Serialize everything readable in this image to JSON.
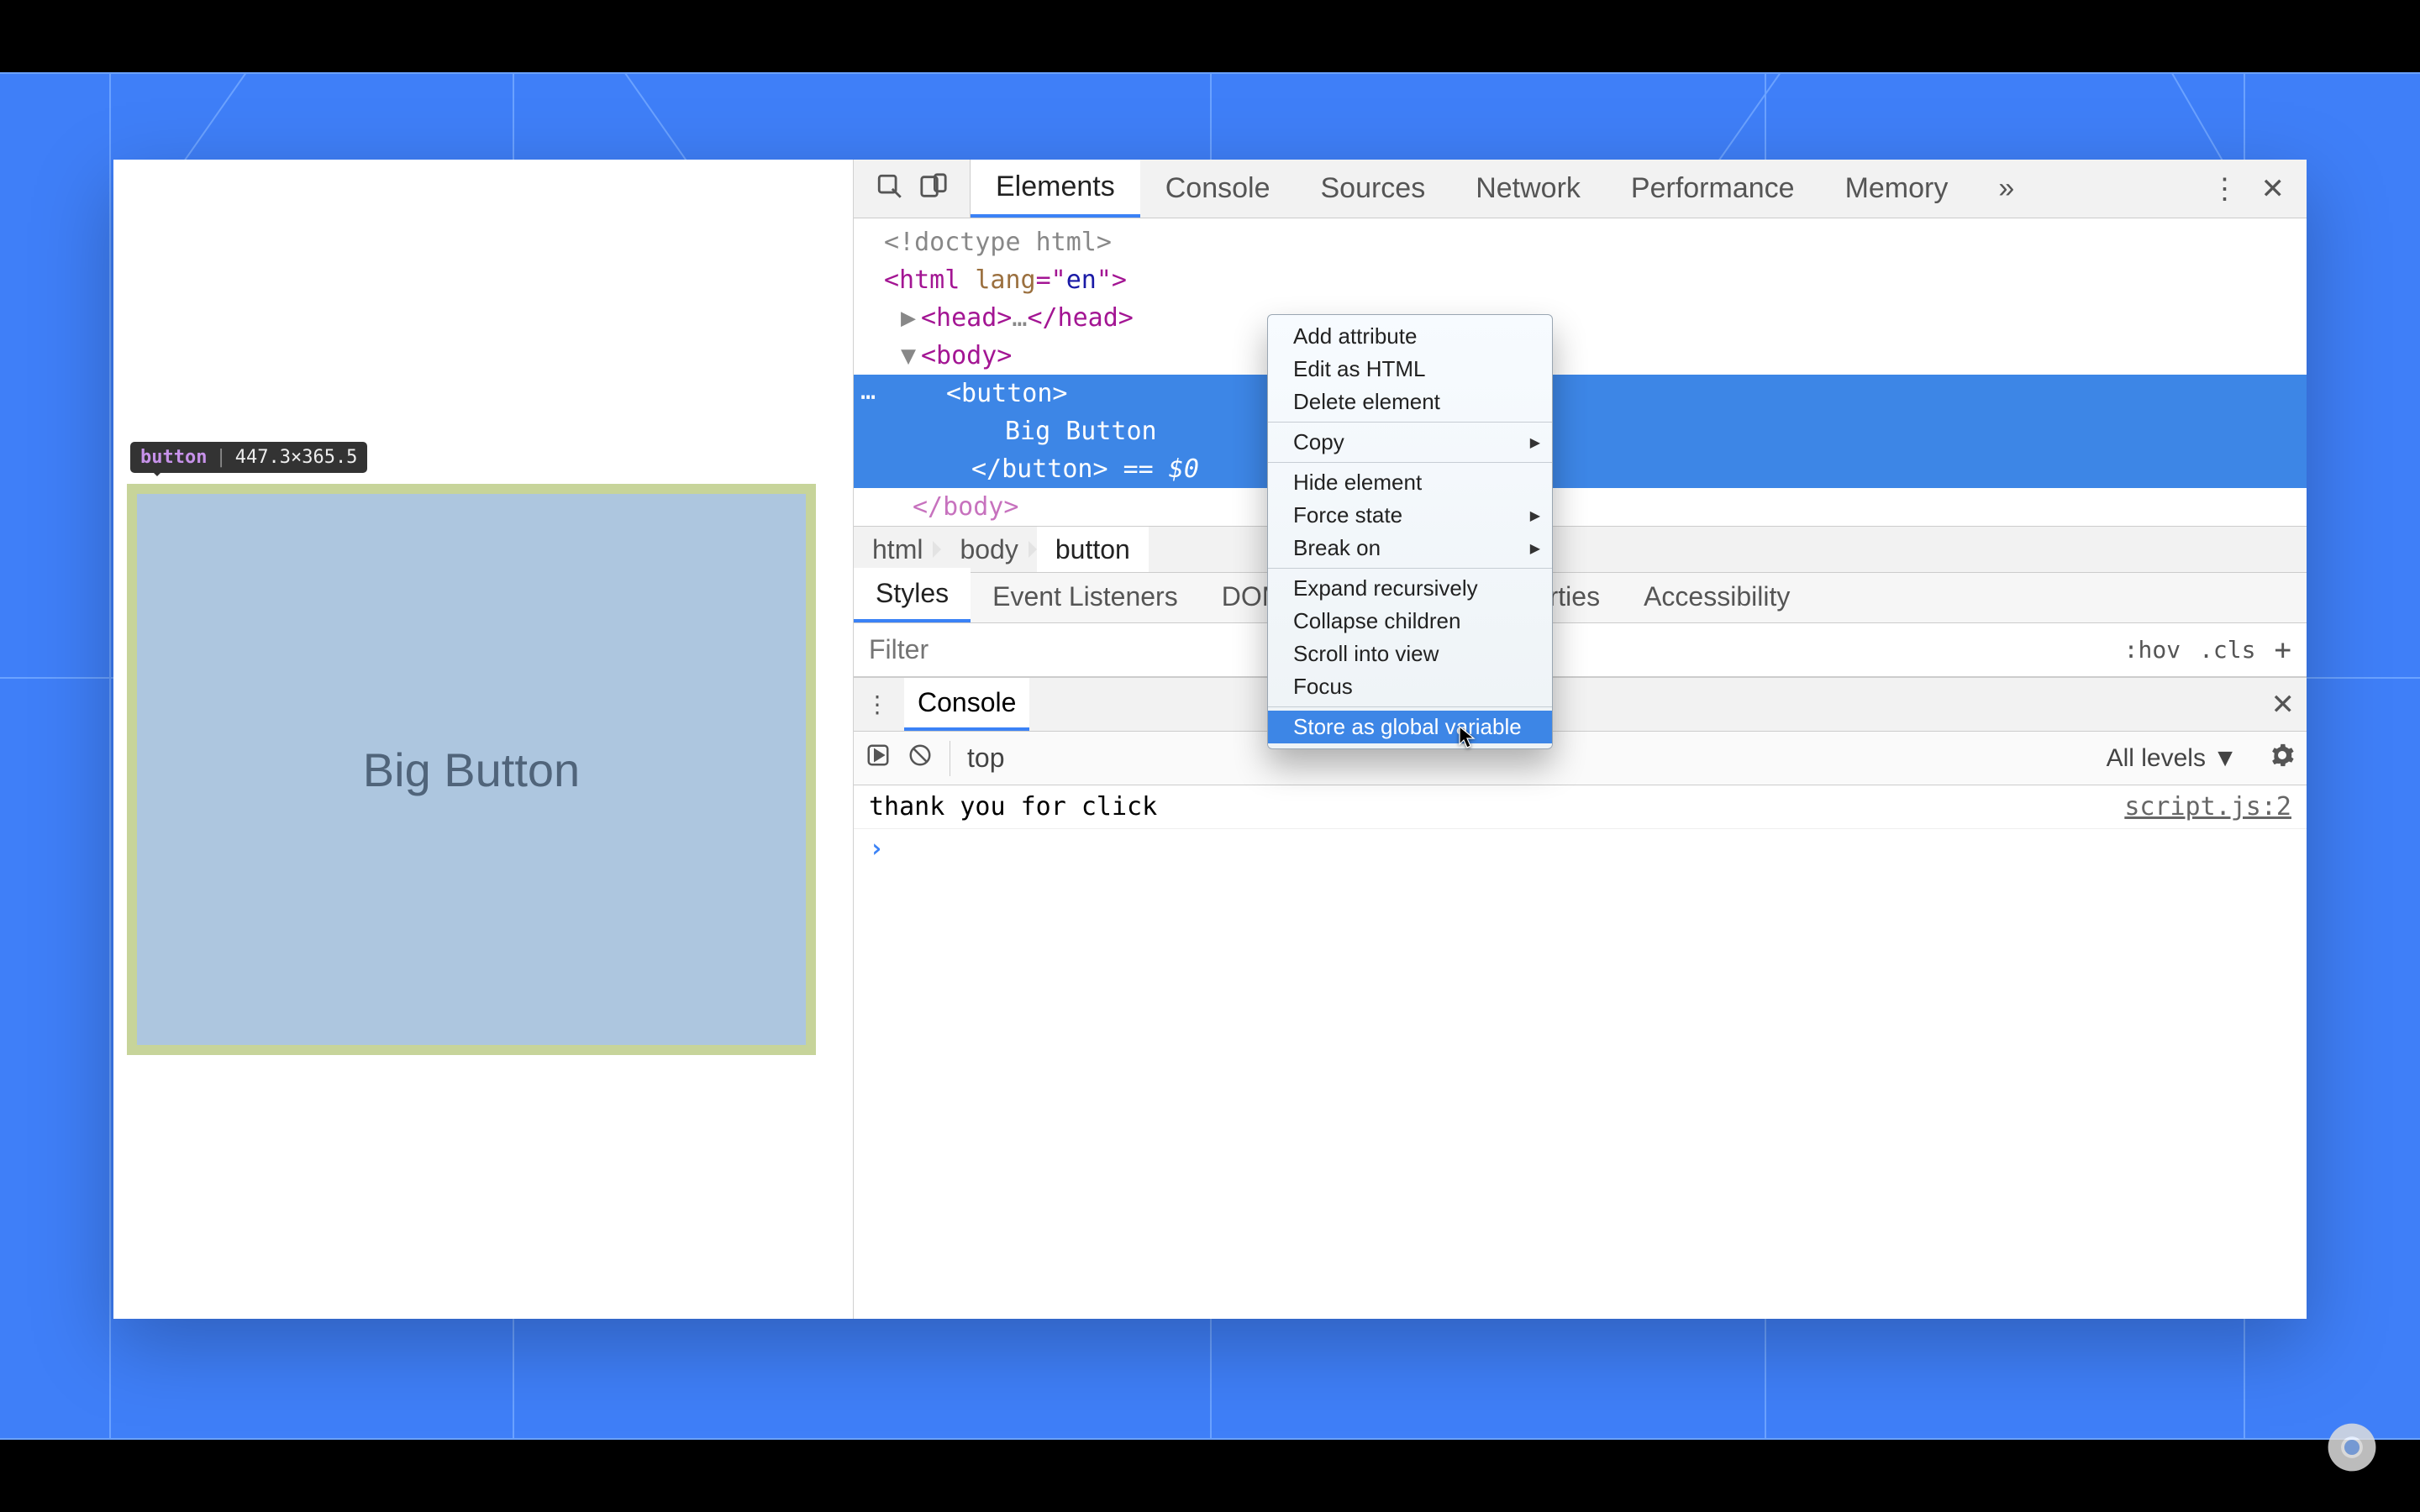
{
  "inspect_tooltip": {
    "tag": "button",
    "dims": "447.3×365.5"
  },
  "preview_button_label": "Big Button",
  "devtools": {
    "tabs": [
      "Elements",
      "Console",
      "Sources",
      "Network",
      "Performance",
      "Memory"
    ],
    "active_tab": "Elements",
    "overflow_glyph": "»",
    "dom": {
      "line0": "<!doctype html>",
      "line1_open": "<html ",
      "line1_attr": "lang",
      "line1_val": "\"en\"",
      "line1_close": ">",
      "head_open": "<head>",
      "head_ell": "…",
      "head_close": "</head>",
      "body_open": "<body>",
      "sel_open": "<button>",
      "sel_text": "Big Button",
      "sel_close": "</button>",
      "sel_suffix": " == $0",
      "body_trunc": "</body>"
    },
    "breadcrumb": [
      "html",
      "body",
      "button"
    ],
    "subtabs": [
      "Styles",
      "Event Listeners",
      "DOM Breakpoints",
      "Properties",
      "Accessibility"
    ],
    "filter_placeholder": "Filter",
    "filter_right": {
      "hov": ":hov",
      "cls": ".cls",
      "plus": "+"
    },
    "console": {
      "title": "Console",
      "top_context": "top",
      "levels": "All levels ▼",
      "log_text": "thank you for click",
      "log_source": "script.js:2",
      "prompt": "›"
    }
  },
  "context_menu": {
    "items": [
      {
        "label": "Add attribute"
      },
      {
        "label": "Edit as HTML"
      },
      {
        "label": "Delete element"
      },
      {
        "sep": true
      },
      {
        "label": "Copy",
        "sub": true
      },
      {
        "sep": true
      },
      {
        "label": "Hide element"
      },
      {
        "label": "Force state",
        "sub": true
      },
      {
        "label": "Break on",
        "sub": true
      },
      {
        "sep": true
      },
      {
        "label": "Expand recursively"
      },
      {
        "label": "Collapse children"
      },
      {
        "label": "Scroll into view"
      },
      {
        "label": "Focus"
      },
      {
        "sep": true
      },
      {
        "label": "Store as global variable",
        "hover": true
      }
    ]
  }
}
